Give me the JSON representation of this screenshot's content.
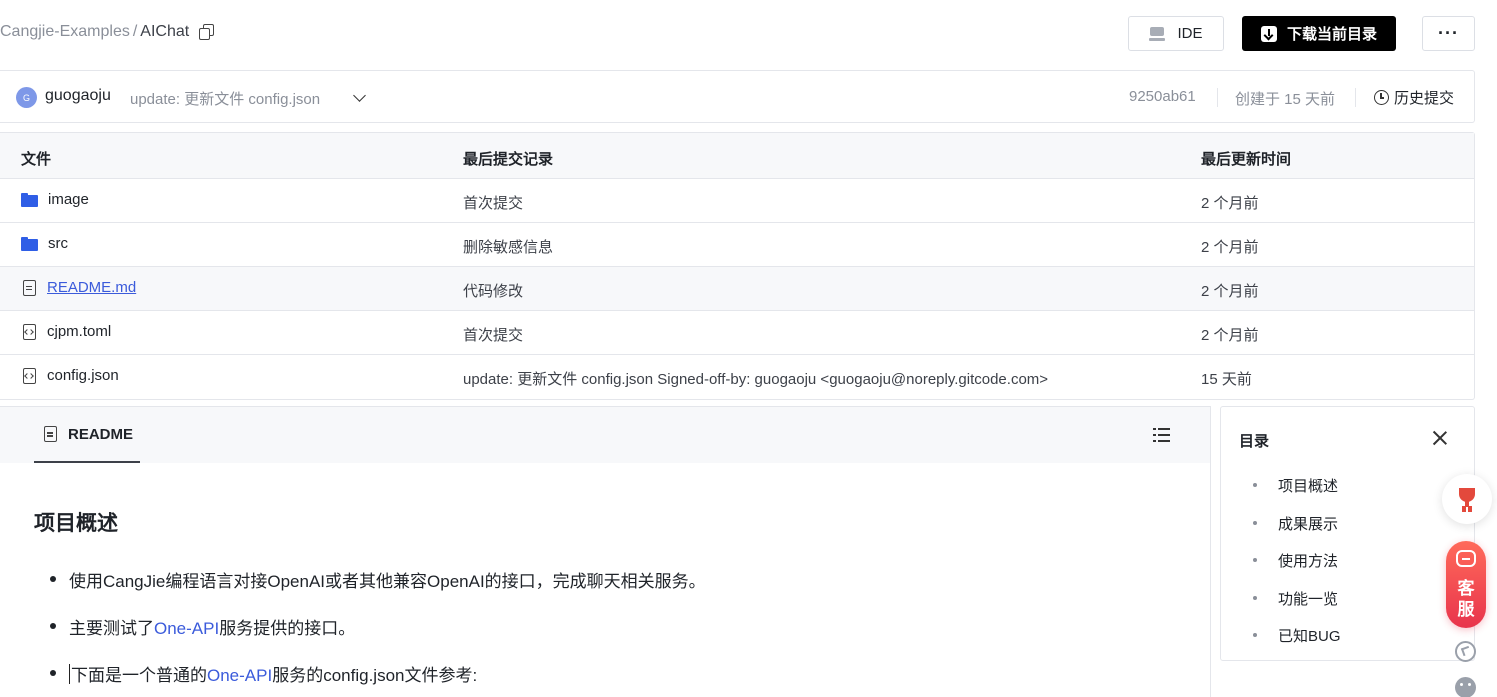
{
  "breadcrumb": {
    "parent": "Cangjie-Examples",
    "separator": "/",
    "current": "AIChat"
  },
  "toolbar": {
    "ide_label": "IDE",
    "download_label": "下载当前目录",
    "more_label": "···"
  },
  "commit": {
    "avatar_initial": "G",
    "author": "guogaoju",
    "message": "update: 更新文件 config.json",
    "hash": "9250ab61",
    "created": "创建于 15 天前",
    "history_label": "历史提交"
  },
  "file_table": {
    "headers": {
      "file": "文件",
      "last_commit": "最后提交记录",
      "updated": "最后更新时间"
    },
    "rows": [
      {
        "name": "image",
        "type": "folder-icon",
        "commit": "首次提交",
        "time": "2 个月前"
      },
      {
        "name": "src",
        "type": "folder-icon",
        "commit": "删除敏感信息",
        "time": "2 个月前"
      },
      {
        "name": "README.md",
        "type": "file-icon",
        "commit": "代码修改",
        "time": "2 个月前"
      },
      {
        "name": "cjpm.toml",
        "type": "code-file-icon",
        "commit": "首次提交",
        "time": "2 个月前"
      },
      {
        "name": "config.json",
        "type": "code-file-icon",
        "commit": "update: 更新文件 config.json Signed-off-by: guogaoju <guogaoju@noreply.gitcode.com>",
        "time": "15 天前"
      }
    ]
  },
  "readme": {
    "tab_label": "README",
    "heading": "项目概述",
    "bullets": [
      {
        "text": "使用CangJie编程语言对接OpenAI或者其他兼容OpenAI的接口，完成聊天相关服务。"
      },
      {
        "pre": "主要测试了",
        "link": "One-API",
        "post": "服务提供的接口。"
      },
      {
        "pre": "下面是一个普通的",
        "link": "One-API",
        "post": "服务的config.json文件参考:"
      }
    ]
  },
  "toc": {
    "title": "目录",
    "items": [
      "项目概述",
      "成果展示",
      "使用方法",
      "功能一览",
      "已知BUG"
    ]
  },
  "floating": {
    "service_line1": "客",
    "service_line2": "服"
  },
  "colors": {
    "accent": "#3b5bdb",
    "folder": "#2f5ee6",
    "service": "#e8344c"
  }
}
